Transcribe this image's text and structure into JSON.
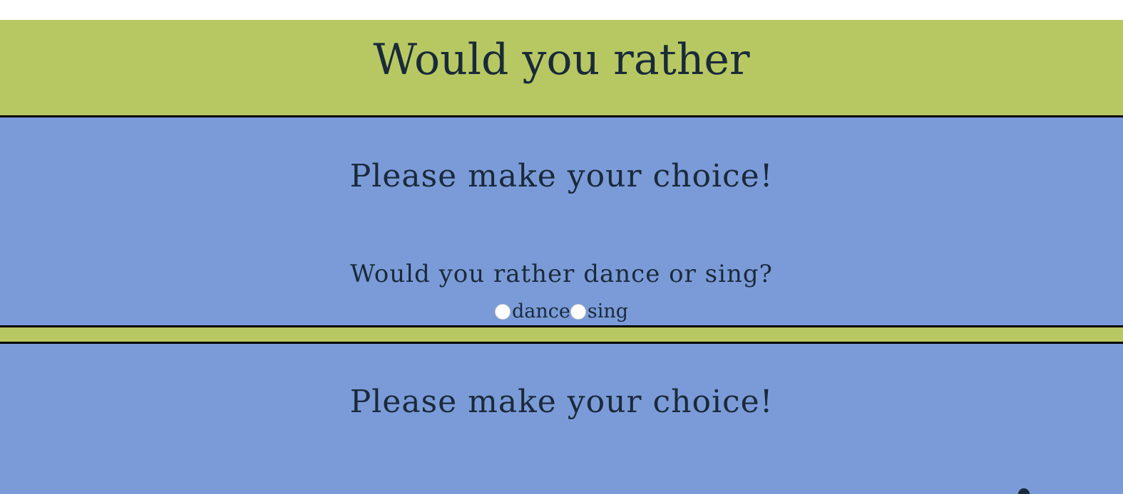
{
  "header": {
    "title": "Would you rather"
  },
  "panels": [
    {
      "heading": "Please make your choice!",
      "question": "Would you rather dance or sing?",
      "options": [
        {
          "label": "dance",
          "selected": false
        },
        {
          "label": "sing",
          "selected": false
        }
      ]
    },
    {
      "heading": "Please make your choice!"
    }
  ],
  "colors": {
    "header_bg": "#b7c862",
    "panel_bg": "#7b9bd8",
    "text": "#1a2a3a",
    "border": "#000000"
  }
}
